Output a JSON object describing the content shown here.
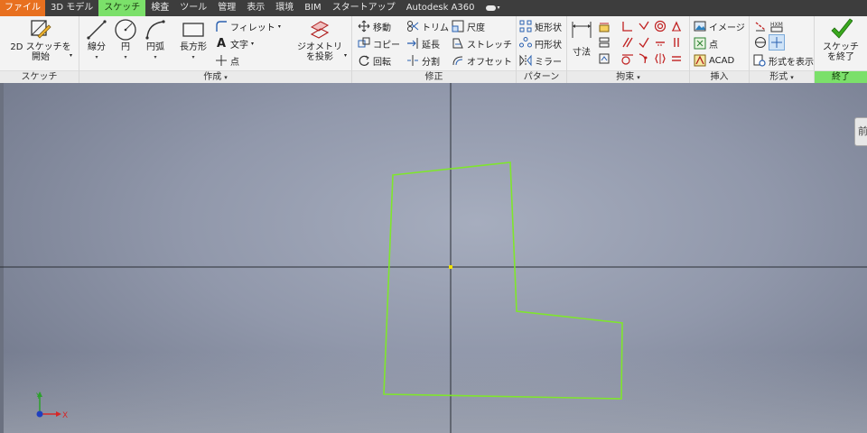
{
  "menu": {
    "tabs": [
      "ファイル",
      "3D モデル",
      "スケッチ",
      "検査",
      "ツール",
      "管理",
      "表示",
      "環境",
      "BIM",
      "スタートアップ",
      "Autodesk A360"
    ],
    "active": "スケッチ"
  },
  "ribbon": {
    "sketch_panel": {
      "label": "スケッチ",
      "start_2d": "2D スケッチを\n開始"
    },
    "create_panel": {
      "label": "作成",
      "line": "線分",
      "circle": "円",
      "arc": "円弧",
      "rectangle": "長方形",
      "fillet": "フィレット",
      "text": "文字",
      "point": "点",
      "project_geometry": "ジオメトリ\nを投影"
    },
    "modify_panel": {
      "label": "修正",
      "move": "移動",
      "copy": "コピー",
      "rotate": "回転",
      "trim": "トリム",
      "extend": "延長",
      "split": "分割",
      "scale": "尺度",
      "stretch": "ストレッチ",
      "offset": "オフセット"
    },
    "pattern_panel": {
      "label": "パターン",
      "rectangular": "矩形状",
      "circular": "円形状",
      "mirror": "ミラー"
    },
    "constrain_panel": {
      "label": "拘束",
      "dimension": "寸法"
    },
    "insert_panel": {
      "label": "挿入",
      "image": "イメージ",
      "points": "点",
      "acad": "ACAD"
    },
    "format_panel": {
      "label": "形式",
      "show_format": "形式を表示"
    },
    "exit_panel": {
      "label": "終了",
      "finish_sketch": "スケッチ\nを終了"
    }
  },
  "canvas": {
    "side_tab": "前",
    "axis_labels": {
      "x": "X",
      "y": "Y"
    },
    "colors": {
      "sketch_line": "#7fe62c",
      "origin": "#f2e400",
      "axis": "#2b2f36"
    }
  }
}
